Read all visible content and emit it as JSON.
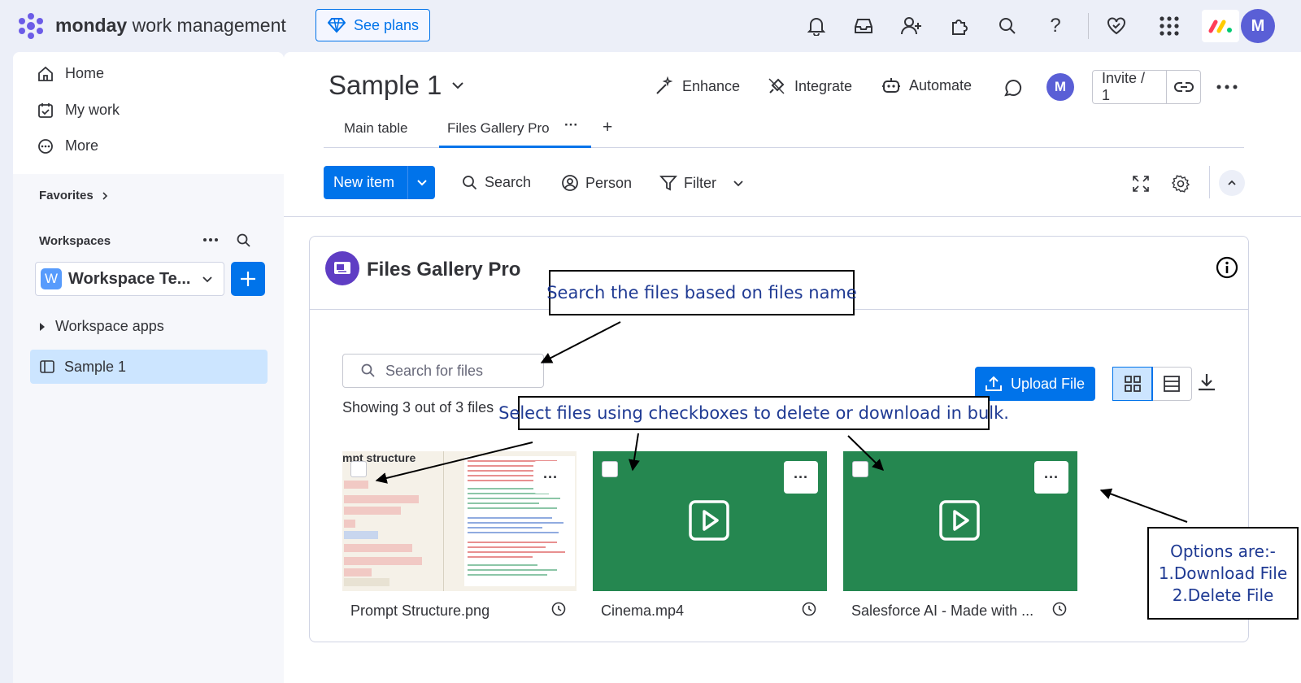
{
  "topbar": {
    "brand_bold": "monday",
    "brand_rest": " work management",
    "see_plans": "See plans",
    "icons": [
      "bell-icon",
      "inbox-icon",
      "invite-member-icon",
      "apps-puzzle-icon",
      "search-icon",
      "help-icon",
      "heart-icon",
      "apps-grid-icon"
    ],
    "avatar": "M"
  },
  "sidebar": {
    "nav": [
      {
        "label": "Home",
        "icon": "home-icon"
      },
      {
        "label": "My work",
        "icon": "calendar-check-icon"
      },
      {
        "label": "More",
        "icon": "more-circle-icon"
      }
    ],
    "favorites": "Favorites",
    "workspaces": "Workspaces",
    "workspace_badge": "W",
    "workspace_name": "Workspace Te...",
    "workspace_apps": "Workspace apps",
    "board": "Sample 1"
  },
  "board": {
    "title": "Sample 1",
    "actions": {
      "enhance": "Enhance",
      "integrate": "Integrate",
      "automate": "Automate"
    },
    "avatar": "M",
    "invite": "Invite / 1",
    "tabs": {
      "main_table": "Main table",
      "files_gallery": "Files Gallery Pro",
      "more": "···",
      "add": "+"
    },
    "toolbar": {
      "new_item": "New item",
      "search": "Search",
      "person": "Person",
      "filter": "Filter"
    }
  },
  "widget": {
    "title": "Files Gallery Pro",
    "search_placeholder": "Search for files",
    "showing": "Showing 3 out of 3 files",
    "upload": "Upload File",
    "files": [
      {
        "name": "Prompt Structure.png",
        "thumb_title": "mpt structure"
      },
      {
        "name": "Cinema.mp4"
      },
      {
        "name": "Salesforce AI - Made with ..."
      }
    ],
    "menu_dots": "···"
  },
  "annotations": {
    "search_note": "Search the files based on files name",
    "select_note": "Select files using checkboxes to delete or download in bulk.",
    "options": [
      "Options are:-",
      "1.Download File",
      "2.Delete File"
    ]
  },
  "colors": {
    "primary": "#0073ea",
    "video_tile": "#258750",
    "selected_bg": "#cce5ff",
    "app_icon": "#5f3dc4"
  }
}
